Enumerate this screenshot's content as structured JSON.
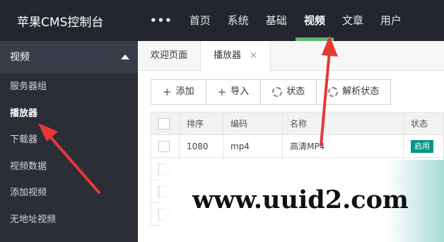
{
  "topbar": {
    "brand": "苹果CMS控制台",
    "more": "•••",
    "nav": [
      "首页",
      "系统",
      "基础",
      "视频",
      "文章",
      "用户"
    ]
  },
  "sidebar": {
    "group": "视频",
    "items": [
      "服务器组",
      "播放器",
      "下载器",
      "视频数据",
      "添加视频",
      "无地址视频"
    ]
  },
  "tabs": {
    "welcome": "欢迎页面",
    "player": "播放器",
    "close": "×"
  },
  "toolbar": {
    "add": "添加",
    "import": "导入",
    "status": "状态",
    "parse_status": "解析状态"
  },
  "table": {
    "headers": [
      "排序",
      "编码",
      "名称",
      "状态"
    ],
    "rows": [
      {
        "sort": "1080",
        "code": "mp4",
        "name": "高清MP4",
        "status": "启用"
      }
    ]
  },
  "watermark": "www.uuid2.com",
  "colors": {
    "topbar": "#23262e",
    "sidebar": "#2b2e37",
    "accent": "#5fb878",
    "badge": "#009688",
    "arrow": "#e53935"
  }
}
